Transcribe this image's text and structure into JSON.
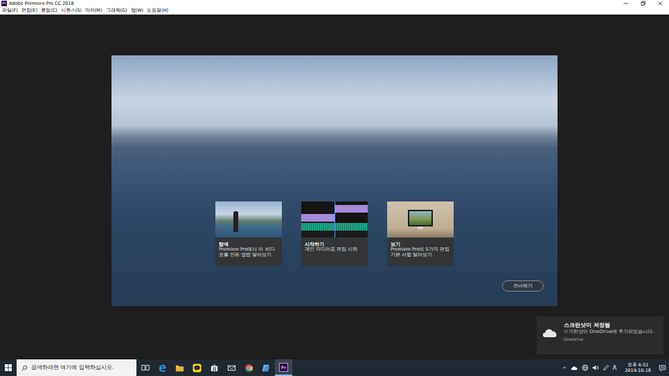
{
  "window": {
    "title": "Adobe Premiere Pro CC 2018",
    "icon_label": "Pr"
  },
  "menu": [
    "파일(F)",
    "편집(E)",
    "클립(C)",
    "시퀀스(S)",
    "마커(M)",
    "그래픽(G)",
    "창(W)",
    "도움말(H)"
  ],
  "welcome": {
    "cards": [
      {
        "kind": "explore",
        "title": "탐색",
        "description": "Premiere Pro에서 이 비디오를 만든 방법 알아보기"
      },
      {
        "kind": "timeline",
        "title": "시작하기",
        "description": "개인 미디어로 편집 시작"
      },
      {
        "kind": "monitor",
        "title": "보기",
        "description": "Premiere Pro의 5가지 편집 기본 사항 알아보기"
      }
    ],
    "skip_button": "건너뛰기"
  },
  "taskbar": {
    "search": {
      "placeholder": "검색하려면 여기에 입력하십시오."
    },
    "apps": [
      {
        "kind": "task-view",
        "selected": false
      },
      {
        "kind": "edge",
        "selected": false
      },
      {
        "kind": "explorer",
        "selected": false
      },
      {
        "kind": "kakaotalk",
        "selected": false
      },
      {
        "kind": "store",
        "selected": false
      },
      {
        "kind": "mail",
        "selected": false
      },
      {
        "kind": "chrome",
        "selected": false
      },
      {
        "kind": "app",
        "selected": false
      },
      {
        "kind": "premiere",
        "label": "Pr",
        "selected": true
      }
    ],
    "input_indicator": "A",
    "time": "오후 6:51",
    "date": "2019-10-18"
  },
  "notification": {
    "title": "스크린샷이 저장됨",
    "body": "스크린샷이 OneDrive에 추가되었습니다.",
    "source": "OneDrive"
  }
}
